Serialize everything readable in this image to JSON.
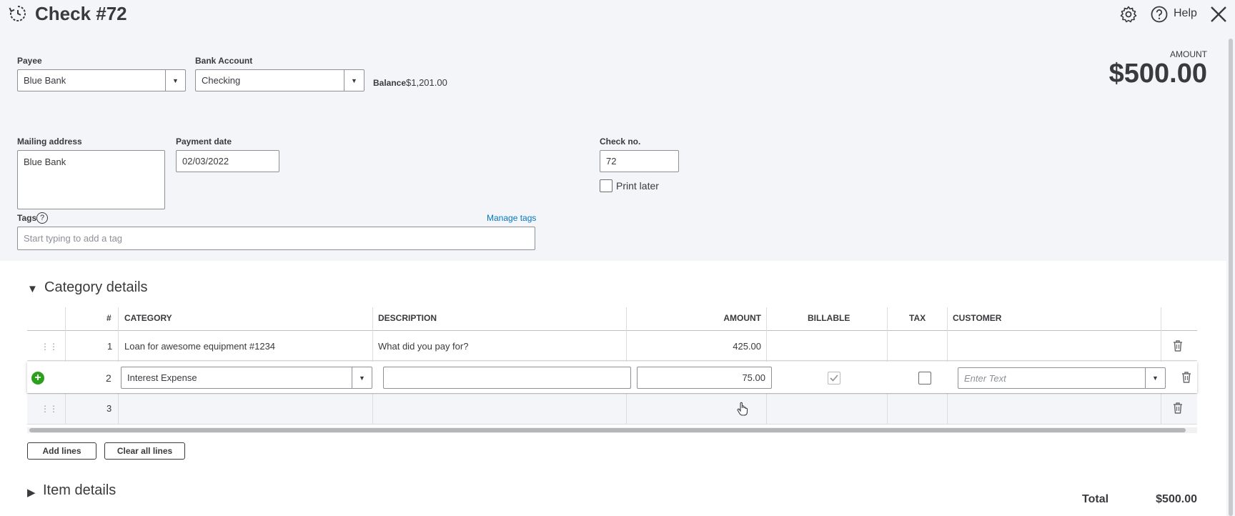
{
  "header": {
    "title": "Check #72",
    "help_label": "Help"
  },
  "form": {
    "payee_label": "Payee",
    "payee_value": "Blue Bank",
    "bank_account_label": "Bank Account",
    "bank_account_value": "Checking",
    "balance_label": "Balance",
    "balance_value": "$1,201.00",
    "amount_label": "AMOUNT",
    "amount_value": "$500.00",
    "mailing_address_label": "Mailing address",
    "mailing_address_value": "Blue Bank",
    "payment_date_label": "Payment date",
    "payment_date_value": "02/03/2022",
    "check_no_label": "Check no.",
    "check_no_value": "72",
    "print_later_label": "Print later",
    "tags_label": "Tags",
    "manage_tags_label": "Manage tags",
    "tags_placeholder": "Start typing to add a tag"
  },
  "category_details": {
    "title": "Category details",
    "columns": {
      "num": "#",
      "category": "CATEGORY",
      "description": "DESCRIPTION",
      "amount": "AMOUNT",
      "billable": "BILLABLE",
      "tax": "TAX",
      "customer": "CUSTOMER"
    },
    "rows": [
      {
        "num": "1",
        "category": "Loan for awesome equipment #1234",
        "description_placeholder": "What did you pay for?",
        "amount": "425.00"
      },
      {
        "num": "2",
        "category": "Interest Expense",
        "description": "",
        "amount": "75.00",
        "customer_placeholder": "Enter Text",
        "billable_checked": true,
        "tax_checked": false
      },
      {
        "num": "3",
        "category": "",
        "amount": ""
      }
    ],
    "add_lines_label": "Add lines",
    "clear_lines_label": "Clear all lines"
  },
  "item_details": {
    "title": "Item details"
  },
  "footer": {
    "total_label": "Total",
    "total_value": "$500.00"
  }
}
